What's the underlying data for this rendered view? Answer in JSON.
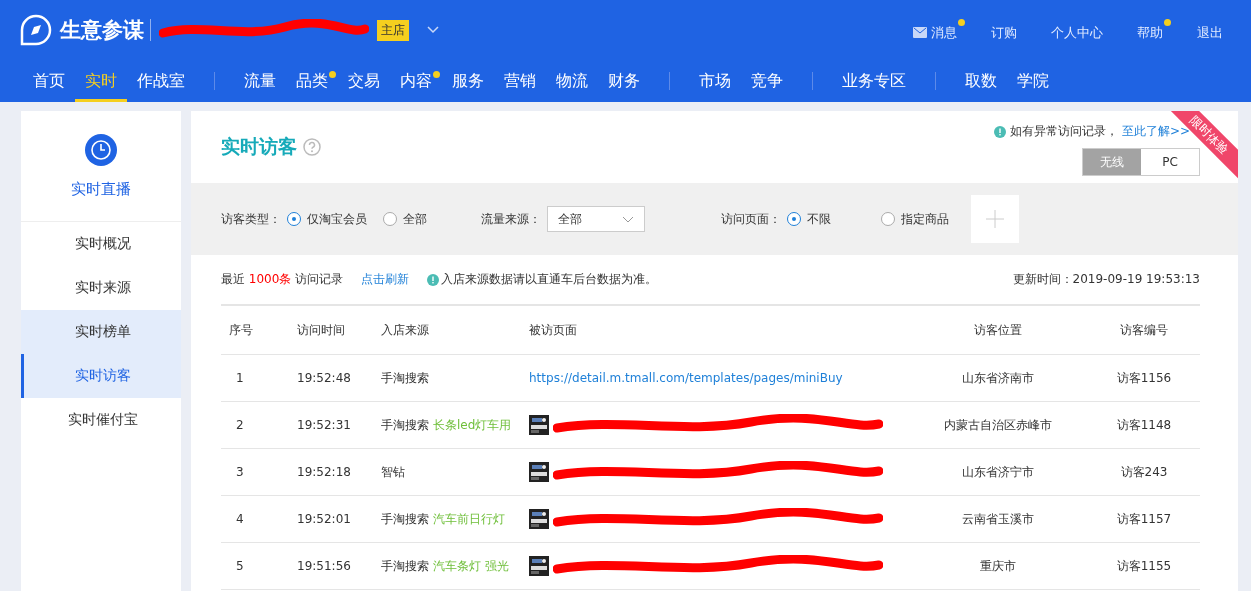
{
  "header": {
    "title": "生意参谋",
    "shop_badge": "主店",
    "top_links": [
      {
        "label": "消息",
        "dot": true,
        "kind": "mail"
      },
      {
        "label": "订购",
        "dot": false
      },
      {
        "label": "个人中心",
        "dot": false
      },
      {
        "label": "帮助",
        "dot": true
      },
      {
        "label": "退出",
        "dot": false
      }
    ],
    "nav_groups": [
      {
        "items": [
          {
            "label": "首页",
            "selected": false,
            "dot": false
          },
          {
            "label": "实时",
            "selected": true,
            "dot": false
          },
          {
            "label": "作战室",
            "selected": false,
            "dot": false
          }
        ]
      },
      {
        "items": [
          {
            "label": "流量",
            "selected": false,
            "dot": false
          },
          {
            "label": "品类",
            "selected": false,
            "dot": true
          },
          {
            "label": "交易",
            "selected": false,
            "dot": false
          },
          {
            "label": "内容",
            "selected": false,
            "dot": true
          },
          {
            "label": "服务",
            "selected": false,
            "dot": false
          },
          {
            "label": "营销",
            "selected": false,
            "dot": false
          },
          {
            "label": "物流",
            "selected": false,
            "dot": false
          },
          {
            "label": "财务",
            "selected": false,
            "dot": false
          }
        ]
      },
      {
        "items": [
          {
            "label": "市场",
            "selected": false,
            "dot": false
          },
          {
            "label": "竞争",
            "selected": false,
            "dot": false
          }
        ]
      },
      {
        "items": [
          {
            "label": "业务专区",
            "selected": false,
            "dot": false
          }
        ]
      },
      {
        "items": [
          {
            "label": "取数",
            "selected": false,
            "dot": false
          },
          {
            "label": "学院",
            "selected": false,
            "dot": false
          }
        ]
      }
    ]
  },
  "sidebar": {
    "title": "实时直播",
    "items": [
      {
        "label": "实时概况",
        "selected": false,
        "highlighted": false
      },
      {
        "label": "实时来源",
        "selected": false,
        "highlighted": false
      },
      {
        "label": "实时榜单",
        "selected": false,
        "highlighted": true
      },
      {
        "label": "实时访客",
        "selected": true,
        "highlighted": true
      },
      {
        "label": "实时催付宝",
        "selected": false,
        "highlighted": false
      }
    ]
  },
  "main": {
    "title": "实时访客",
    "notice": {
      "text": "如有异常访问记录，",
      "link": "至此了解>>"
    },
    "ribbon": "限时体验",
    "device_tabs": [
      {
        "label": "无线",
        "selected": true
      },
      {
        "label": "PC",
        "selected": false
      }
    ],
    "filters": {
      "visitor_type": {
        "label": "访客类型：",
        "options": [
          {
            "label": "仅淘宝会员",
            "selected": true
          },
          {
            "label": "全部",
            "selected": false
          }
        ]
      },
      "traffic_source": {
        "label": "流量来源：",
        "value": "全部"
      },
      "visited_page": {
        "label": "访问页面：",
        "options": [
          {
            "label": "不限",
            "selected": true
          },
          {
            "label": "指定商品",
            "selected": false
          }
        ]
      }
    },
    "summary": {
      "prefix": "最近",
      "count": "1000条",
      "suffix": "访问记录",
      "refresh": "点击刷新",
      "info": "入店来源数据请以直通车后台数据为准。",
      "updated": "更新时间：2019-09-19 19:53:13"
    },
    "table": {
      "columns": [
        "序号",
        "访问时间",
        "入店来源",
        "被访页面",
        "访客位置",
        "访客编号"
      ],
      "rows": [
        {
          "index": "1",
          "time": "19:52:48",
          "source": "手淘搜索",
          "page": {
            "kind": "url",
            "text": "https://detail.m.tmall.com/templates/pages/miniBuy"
          },
          "location": "山东省济南市",
          "visitor": "访客1156"
        },
        {
          "index": "2",
          "time": "19:52:31",
          "source": "手淘搜索",
          "keyword": "长条led灯车用",
          "page": {
            "kind": "redacted"
          },
          "location": "内蒙古自治区赤峰市",
          "visitor": "访客1148"
        },
        {
          "index": "3",
          "time": "19:52:18",
          "source": "智钻",
          "page": {
            "kind": "redacted"
          },
          "location": "山东省济宁市",
          "visitor": "访客243"
        },
        {
          "index": "4",
          "time": "19:52:01",
          "source": "手淘搜索",
          "keyword": "汽车前日行灯",
          "page": {
            "kind": "redacted"
          },
          "location": "云南省玉溪市",
          "visitor": "访客1157"
        },
        {
          "index": "5",
          "time": "19:51:56",
          "source": "手淘搜索",
          "keyword": "汽车条灯 强光",
          "page": {
            "kind": "redacted"
          },
          "location": "重庆市",
          "visitor": "访客1155"
        }
      ]
    }
  }
}
